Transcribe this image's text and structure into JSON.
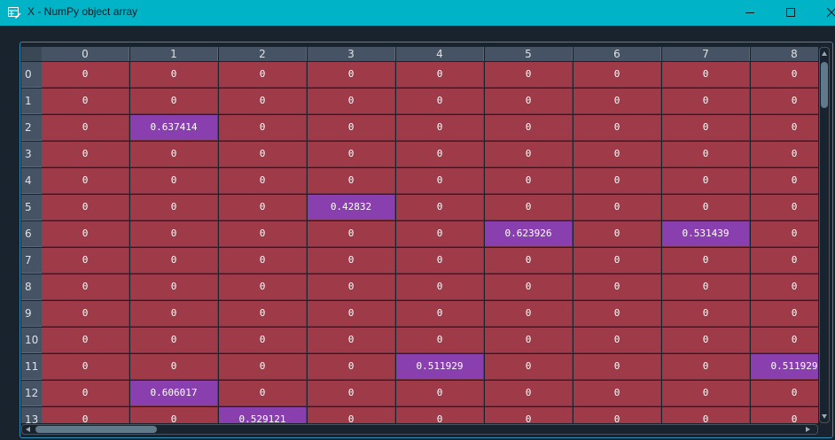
{
  "window": {
    "title": "X - NumPy object array",
    "icons": {
      "app": "table-edit-icon",
      "minimize": "minimize-icon",
      "maximize": "maximize-icon",
      "close": "close-icon"
    }
  },
  "grid": {
    "columns": [
      "0",
      "1",
      "2",
      "3",
      "4",
      "5",
      "6",
      "7",
      "8"
    ],
    "rows": [
      "0",
      "1",
      "2",
      "3",
      "4",
      "5",
      "6",
      "7",
      "8",
      "9",
      "10",
      "11",
      "12",
      "13"
    ],
    "cells": [
      [
        "0",
        "0",
        "0",
        "0",
        "0",
        "0",
        "0",
        "0",
        "0"
      ],
      [
        "0",
        "0",
        "0",
        "0",
        "0",
        "0",
        "0",
        "0",
        "0"
      ],
      [
        "0",
        "0.637414",
        "0",
        "0",
        "0",
        "0",
        "0",
        "0",
        "0"
      ],
      [
        "0",
        "0",
        "0",
        "0",
        "0",
        "0",
        "0",
        "0",
        "0"
      ],
      [
        "0",
        "0",
        "0",
        "0",
        "0",
        "0",
        "0",
        "0",
        "0"
      ],
      [
        "0",
        "0",
        "0",
        "0.42832",
        "0",
        "0",
        "0",
        "0",
        "0"
      ],
      [
        "0",
        "0",
        "0",
        "0",
        "0",
        "0.623926",
        "0",
        "0.531439",
        "0"
      ],
      [
        "0",
        "0",
        "0",
        "0",
        "0",
        "0",
        "0",
        "0",
        "0"
      ],
      [
        "0",
        "0",
        "0",
        "0",
        "0",
        "0",
        "0",
        "0",
        "0"
      ],
      [
        "0",
        "0",
        "0",
        "0",
        "0",
        "0",
        "0",
        "0",
        "0"
      ],
      [
        "0",
        "0",
        "0",
        "0",
        "0",
        "0",
        "0",
        "0",
        "0"
      ],
      [
        "0",
        "0",
        "0",
        "0",
        "0.511929",
        "0",
        "0",
        "0",
        "0.511929"
      ],
      [
        "0",
        "0.606017",
        "0",
        "0",
        "0",
        "0",
        "0",
        "0",
        "0"
      ],
      [
        "0",
        "0",
        "0.529121",
        "0",
        "0",
        "0",
        "0",
        "0",
        "0"
      ]
    ]
  },
  "colors": {
    "zero_cell": "#9f3a48",
    "value_cell": "#8a3fae",
    "titlebar": "#00b3c7",
    "header": "#455364"
  }
}
